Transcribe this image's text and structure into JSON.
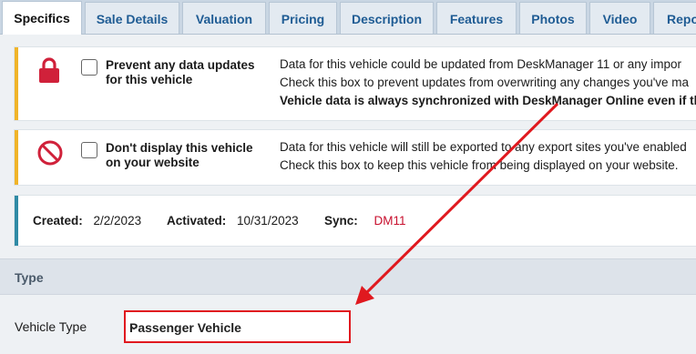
{
  "tabs": [
    "Specifics",
    "Sale Details",
    "Valuation",
    "Pricing",
    "Description",
    "Features",
    "Photos",
    "Video",
    "Repo"
  ],
  "prevent_updates": {
    "label": "Prevent any data updates for this vehicle",
    "desc_line1": "Data for this vehicle could be updated from DeskManager 11 or any impor",
    "desc_line2": "Check this box to prevent updates from overwriting any changes you've ma",
    "desc_line3": "Vehicle data is always synchronized with DeskManager Online even if this"
  },
  "dont_display": {
    "label": "Don't display this vehicle on your website",
    "desc_line1": "Data for this vehicle will still be exported to any export sites you've enabled",
    "desc_line2": "Check this box to keep this vehicle from being displayed on your website."
  },
  "meta": {
    "created_label": "Created:",
    "created_value": "2/2/2023",
    "activated_label": "Activated:",
    "activated_value": "10/31/2023",
    "sync_label": "Sync:",
    "sync_value": "DM11"
  },
  "type_section": {
    "title": "Type"
  },
  "vehicle_type": {
    "label": "Vehicle Type",
    "value": "Passenger Vehicle"
  },
  "icons": {
    "lock": "lock-icon",
    "no": "no-icon",
    "chevron": "chevron-down-icon"
  },
  "colors": {
    "accent_yellow": "#f0b429",
    "accent_teal": "#2f8aa5",
    "highlight_red": "#e0191f",
    "sync_red": "#c8102e",
    "tab_text": "#1f5c94"
  }
}
